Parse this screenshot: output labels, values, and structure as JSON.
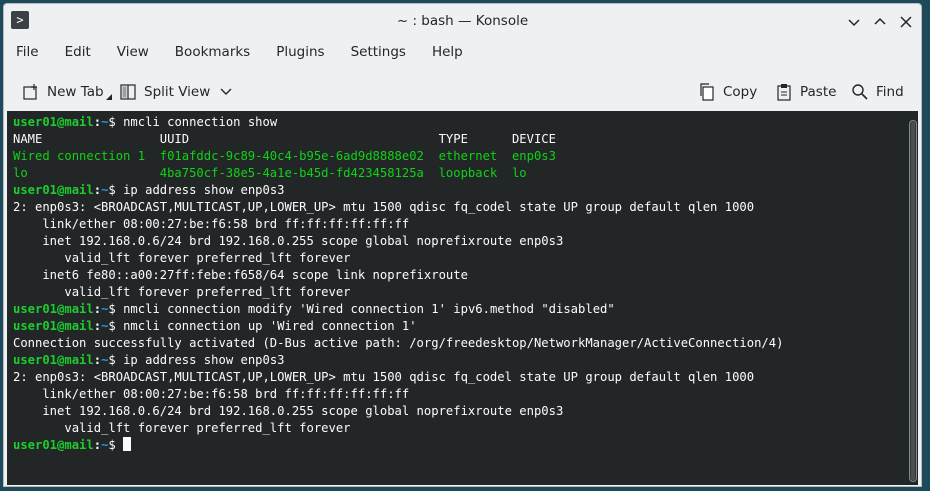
{
  "window": {
    "title": "~ : bash — Konsole"
  },
  "menu": [
    "File",
    "Edit",
    "View",
    "Bookmarks",
    "Plugins",
    "Settings",
    "Help"
  ],
  "toolbar": {
    "new_tab": "New Tab",
    "split_view": "Split View",
    "copy": "Copy",
    "paste": "Paste",
    "find": "Find"
  },
  "terminal": {
    "prompt_user": "user01@mail",
    "prompt_path": "~",
    "lines": [
      {
        "type": "cmd",
        "text": "nmcli connection show"
      },
      {
        "type": "out",
        "text": "NAME                UUID                                  TYPE      DEVICE"
      },
      {
        "type": "green",
        "text": "Wired connection 1  f01afddc-9c89-40c4-b95e-6ad9d8888e02  ethernet  enp0s3"
      },
      {
        "type": "green",
        "text": "lo                  4ba750cf-38e5-4a1e-b45d-fd423458125a  loopback  lo"
      },
      {
        "type": "cmd",
        "text": "ip address show enp0s3"
      },
      {
        "type": "out",
        "text": "2: enp0s3: <BROADCAST,MULTICAST,UP,LOWER_UP> mtu 1500 qdisc fq_codel state UP group default qlen 1000"
      },
      {
        "type": "out",
        "text": "    link/ether 08:00:27:be:f6:58 brd ff:ff:ff:ff:ff:ff"
      },
      {
        "type": "out",
        "text": "    inet 192.168.0.6/24 brd 192.168.0.255 scope global noprefixroute enp0s3"
      },
      {
        "type": "out",
        "text": "       valid_lft forever preferred_lft forever"
      },
      {
        "type": "out",
        "text": "    inet6 fe80::a00:27ff:febe:f658/64 scope link noprefixroute"
      },
      {
        "type": "out",
        "text": "       valid_lft forever preferred_lft forever"
      },
      {
        "type": "cmd",
        "text": "nmcli connection modify 'Wired connection 1' ipv6.method \"disabled\""
      },
      {
        "type": "cmd",
        "text": "nmcli connection up 'Wired connection 1'"
      },
      {
        "type": "out",
        "text": "Connection successfully activated (D-Bus active path: /org/freedesktop/NetworkManager/ActiveConnection/4)"
      },
      {
        "type": "cmd",
        "text": "ip address show enp0s3"
      },
      {
        "type": "out",
        "text": "2: enp0s3: <BROADCAST,MULTICAST,UP,LOWER_UP> mtu 1500 qdisc fq_codel state UP group default qlen 1000"
      },
      {
        "type": "out",
        "text": "    link/ether 08:00:27:be:f6:58 brd ff:ff:ff:ff:ff:ff"
      },
      {
        "type": "out",
        "text": "    inet 192.168.0.6/24 brd 192.168.0.255 scope global noprefixroute enp0s3"
      },
      {
        "type": "out",
        "text": "       valid_lft forever preferred_lft forever"
      },
      {
        "type": "prompt",
        "text": ""
      }
    ]
  }
}
